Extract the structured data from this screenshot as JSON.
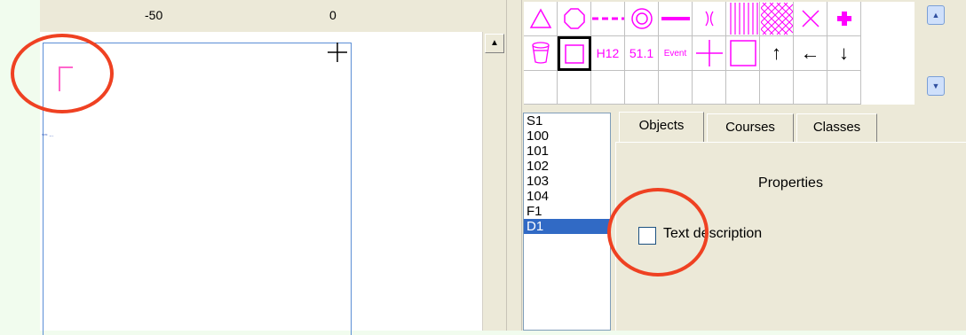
{
  "ruler": {
    "tick_left": "-50",
    "tick_right": "0"
  },
  "map": {
    "small_label": "≈≈ ..."
  },
  "palette": {
    "row1": [
      "△",
      "⬡",
      "- - -",
      "◎",
      "━",
      "⟩⟨",
      "|||",
      "▩",
      "×",
      "✚"
    ],
    "row2": [
      "⊖",
      "□",
      "H12",
      "51.1",
      "Event",
      "+",
      "□",
      "↑",
      "←",
      "↓"
    ],
    "scroll_up": "▲",
    "scroll_down": "▼"
  },
  "list": {
    "items": [
      "S1",
      "100",
      "101",
      "102",
      "103",
      "104",
      "F1",
      "D1"
    ],
    "selected": "D1"
  },
  "tabs": {
    "objects": "Objects",
    "courses": "Courses",
    "classes": "Classes"
  },
  "panel": {
    "properties_title": "Properties",
    "text_description_label": "Text description"
  },
  "colors": {
    "accent": "#ff00ff",
    "highlight_ring": "#ef4122",
    "selection": "#316ac5"
  }
}
